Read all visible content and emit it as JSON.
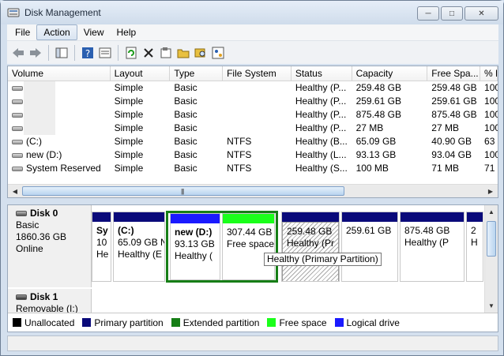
{
  "window": {
    "title": "Disk Management"
  },
  "menu": [
    "File",
    "Action",
    "View",
    "Help"
  ],
  "toolbar_icons": [
    "back-icon",
    "forward-icon",
    "console-tree-icon",
    "help-icon",
    "properties-view-icon",
    "refresh-icon",
    "delete-icon",
    "properties-icon",
    "open-icon",
    "explore-icon",
    "wizard-icon"
  ],
  "volumes": {
    "columns": [
      "Volume",
      "Layout",
      "Type",
      "File System",
      "Status",
      "Capacity",
      "Free Spa...",
      "% F"
    ],
    "rows": [
      [
        "",
        "Simple",
        "Basic",
        "",
        "Healthy (P...",
        "259.48 GB",
        "259.48 GB",
        "100"
      ],
      [
        "",
        "Simple",
        "Basic",
        "",
        "Healthy (P...",
        "259.61 GB",
        "259.61 GB",
        "100"
      ],
      [
        "",
        "Simple",
        "Basic",
        "",
        "Healthy (P...",
        "875.48 GB",
        "875.48 GB",
        "100"
      ],
      [
        "",
        "Simple",
        "Basic",
        "",
        "Healthy (P...",
        "27 MB",
        "27 MB",
        "100"
      ],
      [
        "(C:)",
        "Simple",
        "Basic",
        "NTFS",
        "Healthy (B...",
        "65.09 GB",
        "40.90 GB",
        "63"
      ],
      [
        "new (D:)",
        "Simple",
        "Basic",
        "NTFS",
        "Healthy (L...",
        "93.13 GB",
        "93.04 GB",
        "100"
      ],
      [
        "System Reserved",
        "Simple",
        "Basic",
        "NTFS",
        "Healthy (S...",
        "100 MB",
        "71 MB",
        "71"
      ]
    ]
  },
  "disk0": {
    "name": "Disk 0",
    "type": "Basic",
    "size": "1860.36 GB",
    "status": "Online",
    "partitions": [
      {
        "name": "Sy",
        "size": "10",
        "status": "He"
      },
      {
        "name": "(C:)",
        "size": "65.09 GB N",
        "status": "Healthy (E"
      },
      {
        "name": "new  (D:)",
        "size": "93.13 GB",
        "status": "Healthy ("
      },
      {
        "name": "",
        "size": "307.44 GB",
        "status": "Free space"
      },
      {
        "name": "",
        "size": "259.48 GB",
        "status": "Healthy (Pr"
      },
      {
        "name": "",
        "size": "259.61 GB",
        "status": ""
      },
      {
        "name": "",
        "size": "875.48 GB",
        "status": "Healthy (P"
      },
      {
        "name": "",
        "size": "2",
        "status": "H"
      }
    ],
    "tooltip": "Healthy (Primary Partition)"
  },
  "disk1": {
    "name": "Disk 1",
    "type": "Removable (I:)"
  },
  "legend": [
    {
      "label": "Unallocated",
      "color": "#000000"
    },
    {
      "label": "Primary partition",
      "color": "#0a0a7a"
    },
    {
      "label": "Extended partition",
      "color": "#167e16"
    },
    {
      "label": "Free space",
      "color": "#1aff1a"
    },
    {
      "label": "Logical drive",
      "color": "#1a1aff"
    }
  ]
}
